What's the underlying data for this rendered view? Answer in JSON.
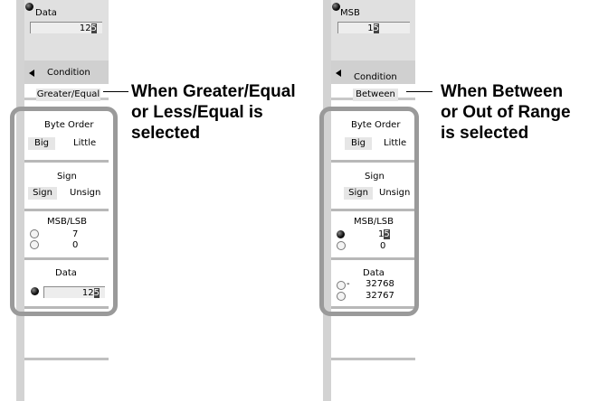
{
  "left": {
    "top_label": "Data",
    "top_value_main": "12",
    "top_value_cursor": "5",
    "condition_label": "Condition",
    "condition_value": "Greater/Equal",
    "byte_order": {
      "title": "Byte Order",
      "opt1": "Big",
      "opt2": "Little"
    },
    "sign": {
      "title": "Sign",
      "opt1": "Sign",
      "opt2": "Unsign"
    },
    "msblsb": {
      "title": "MSB/LSB",
      "msb": "7",
      "lsb": "0"
    },
    "data": {
      "title": "Data",
      "value_main": "12",
      "value_cursor": "5"
    },
    "callout": [
      "When Greater/Equal",
      "or Less/Equal is",
      "selected"
    ]
  },
  "right": {
    "top_label": "MSB",
    "top_value_main": "1",
    "top_value_cursor": "5",
    "condition_label": "Condition",
    "condition_value": "Between",
    "byte_order": {
      "title": "Byte Order",
      "opt1": "Big",
      "opt2": "Little"
    },
    "sign": {
      "title": "Sign",
      "opt1": "Sign",
      "opt2": "Unsign"
    },
    "msblsb": {
      "title": "MSB/LSB",
      "msb_main": "1",
      "msb_cursor": "5",
      "lsb": "0"
    },
    "data": {
      "title": "Data",
      "minus": "-",
      "low": "32768",
      "high": "32767"
    },
    "callout": [
      "When Between",
      "or Out of Range",
      "is selected"
    ]
  }
}
